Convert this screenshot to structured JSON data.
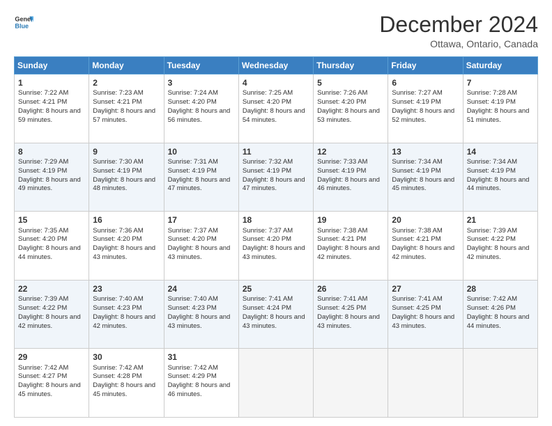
{
  "logo": {
    "line1": "General",
    "line2": "Blue"
  },
  "header": {
    "title": "December 2024",
    "subtitle": "Ottawa, Ontario, Canada"
  },
  "days": [
    "Sunday",
    "Monday",
    "Tuesday",
    "Wednesday",
    "Thursday",
    "Friday",
    "Saturday"
  ],
  "weeks": [
    [
      {
        "day": "1",
        "sunrise": "7:22 AM",
        "sunset": "4:21 PM",
        "daylight": "8 hours and 59 minutes."
      },
      {
        "day": "2",
        "sunrise": "7:23 AM",
        "sunset": "4:21 PM",
        "daylight": "8 hours and 57 minutes."
      },
      {
        "day": "3",
        "sunrise": "7:24 AM",
        "sunset": "4:20 PM",
        "daylight": "8 hours and 56 minutes."
      },
      {
        "day": "4",
        "sunrise": "7:25 AM",
        "sunset": "4:20 PM",
        "daylight": "8 hours and 54 minutes."
      },
      {
        "day": "5",
        "sunrise": "7:26 AM",
        "sunset": "4:20 PM",
        "daylight": "8 hours and 53 minutes."
      },
      {
        "day": "6",
        "sunrise": "7:27 AM",
        "sunset": "4:19 PM",
        "daylight": "8 hours and 52 minutes."
      },
      {
        "day": "7",
        "sunrise": "7:28 AM",
        "sunset": "4:19 PM",
        "daylight": "8 hours and 51 minutes."
      }
    ],
    [
      {
        "day": "8",
        "sunrise": "7:29 AM",
        "sunset": "4:19 PM",
        "daylight": "8 hours and 49 minutes."
      },
      {
        "day": "9",
        "sunrise": "7:30 AM",
        "sunset": "4:19 PM",
        "daylight": "8 hours and 48 minutes."
      },
      {
        "day": "10",
        "sunrise": "7:31 AM",
        "sunset": "4:19 PM",
        "daylight": "8 hours and 47 minutes."
      },
      {
        "day": "11",
        "sunrise": "7:32 AM",
        "sunset": "4:19 PM",
        "daylight": "8 hours and 47 minutes."
      },
      {
        "day": "12",
        "sunrise": "7:33 AM",
        "sunset": "4:19 PM",
        "daylight": "8 hours and 46 minutes."
      },
      {
        "day": "13",
        "sunrise": "7:34 AM",
        "sunset": "4:19 PM",
        "daylight": "8 hours and 45 minutes."
      },
      {
        "day": "14",
        "sunrise": "7:34 AM",
        "sunset": "4:19 PM",
        "daylight": "8 hours and 44 minutes."
      }
    ],
    [
      {
        "day": "15",
        "sunrise": "7:35 AM",
        "sunset": "4:20 PM",
        "daylight": "8 hours and 44 minutes."
      },
      {
        "day": "16",
        "sunrise": "7:36 AM",
        "sunset": "4:20 PM",
        "daylight": "8 hours and 43 minutes."
      },
      {
        "day": "17",
        "sunrise": "7:37 AM",
        "sunset": "4:20 PM",
        "daylight": "8 hours and 43 minutes."
      },
      {
        "day": "18",
        "sunrise": "7:37 AM",
        "sunset": "4:20 PM",
        "daylight": "8 hours and 43 minutes."
      },
      {
        "day": "19",
        "sunrise": "7:38 AM",
        "sunset": "4:21 PM",
        "daylight": "8 hours and 42 minutes."
      },
      {
        "day": "20",
        "sunrise": "7:38 AM",
        "sunset": "4:21 PM",
        "daylight": "8 hours and 42 minutes."
      },
      {
        "day": "21",
        "sunrise": "7:39 AM",
        "sunset": "4:22 PM",
        "daylight": "8 hours and 42 minutes."
      }
    ],
    [
      {
        "day": "22",
        "sunrise": "7:39 AM",
        "sunset": "4:22 PM",
        "daylight": "8 hours and 42 minutes."
      },
      {
        "day": "23",
        "sunrise": "7:40 AM",
        "sunset": "4:23 PM",
        "daylight": "8 hours and 42 minutes."
      },
      {
        "day": "24",
        "sunrise": "7:40 AM",
        "sunset": "4:23 PM",
        "daylight": "8 hours and 43 minutes."
      },
      {
        "day": "25",
        "sunrise": "7:41 AM",
        "sunset": "4:24 PM",
        "daylight": "8 hours and 43 minutes."
      },
      {
        "day": "26",
        "sunrise": "7:41 AM",
        "sunset": "4:25 PM",
        "daylight": "8 hours and 43 minutes."
      },
      {
        "day": "27",
        "sunrise": "7:41 AM",
        "sunset": "4:25 PM",
        "daylight": "8 hours and 43 minutes."
      },
      {
        "day": "28",
        "sunrise": "7:42 AM",
        "sunset": "4:26 PM",
        "daylight": "8 hours and 44 minutes."
      }
    ],
    [
      {
        "day": "29",
        "sunrise": "7:42 AM",
        "sunset": "4:27 PM",
        "daylight": "8 hours and 45 minutes."
      },
      {
        "day": "30",
        "sunrise": "7:42 AM",
        "sunset": "4:28 PM",
        "daylight": "8 hours and 45 minutes."
      },
      {
        "day": "31",
        "sunrise": "7:42 AM",
        "sunset": "4:29 PM",
        "daylight": "8 hours and 46 minutes."
      },
      null,
      null,
      null,
      null
    ]
  ]
}
